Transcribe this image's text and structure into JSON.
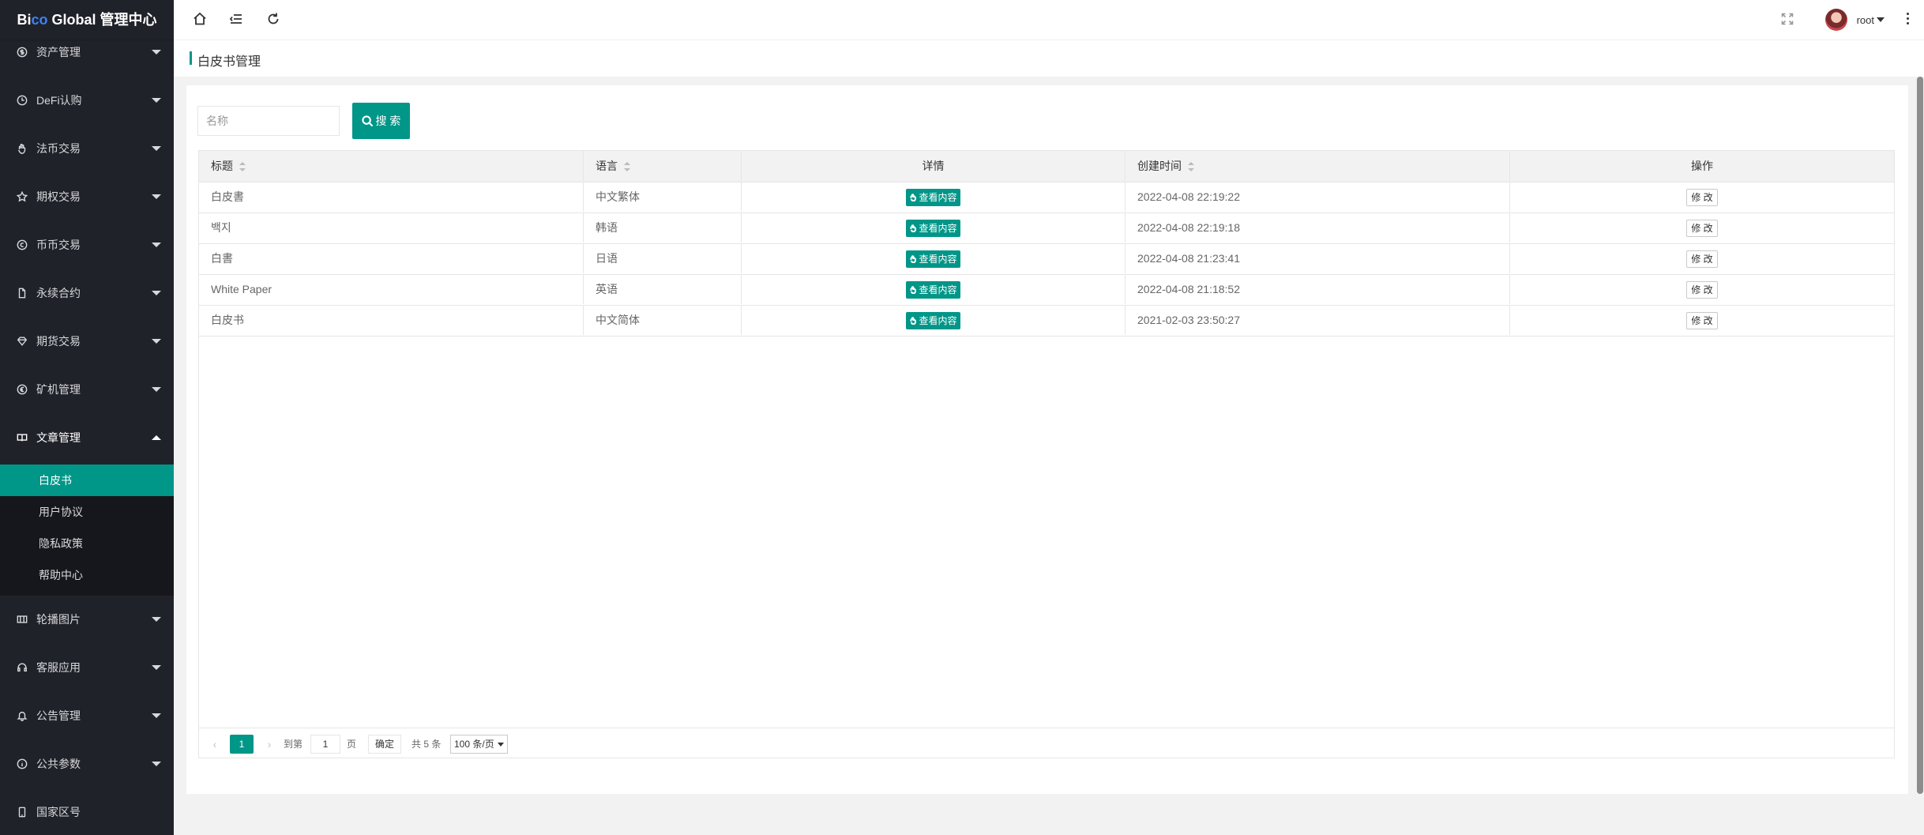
{
  "app": {
    "title_a": "Bi",
    "title_co": "co",
    "title_b": " Global 管理中心"
  },
  "sidebar": {
    "items": [
      {
        "label": "资产管理",
        "icon": "dollar-icon"
      },
      {
        "label": "DeFi认购",
        "icon": "clock-icon"
      },
      {
        "label": "法币交易",
        "icon": "hand-icon"
      },
      {
        "label": "期权交易",
        "icon": "star-icon"
      },
      {
        "label": "币币交易",
        "icon": "coin-icon"
      },
      {
        "label": "永续合约",
        "icon": "file-icon"
      },
      {
        "label": "期货交易",
        "icon": "diamond-icon"
      },
      {
        "label": "矿机管理",
        "icon": "euro-icon"
      },
      {
        "label": "文章管理",
        "icon": "book-icon"
      },
      {
        "label": "轮播图片",
        "icon": "image-icon"
      },
      {
        "label": "客服应用",
        "icon": "headset-icon"
      },
      {
        "label": "公告管理",
        "icon": "bell-icon"
      },
      {
        "label": "公共参数",
        "icon": "info-icon"
      },
      {
        "label": "国家区号",
        "icon": "phone-icon"
      }
    ],
    "submenu": [
      "白皮书",
      "用户协议",
      "隐私政策",
      "帮助中心"
    ]
  },
  "header": {
    "username": "root"
  },
  "page": {
    "title": "白皮书管理"
  },
  "search": {
    "placeholder": "名称",
    "button": "搜 索"
  },
  "table": {
    "columns": [
      "标题",
      "语言",
      "详情",
      "创建时间",
      "操作"
    ],
    "view_label": "查看内容",
    "edit_label": "修 改",
    "rows": [
      {
        "title": "白皮書",
        "lang": "中文繁体",
        "created": "2022-04-08 22:19:22"
      },
      {
        "title": "백지",
        "lang": "韩语",
        "created": "2022-04-08 22:19:18"
      },
      {
        "title": "白書",
        "lang": "日语",
        "created": "2022-04-08 21:23:41"
      },
      {
        "title": "White Paper",
        "lang": "英语",
        "created": "2022-04-08 21:18:52"
      },
      {
        "title": "白皮书",
        "lang": "中文简体",
        "created": "2021-02-03 23:50:27"
      }
    ]
  },
  "pager": {
    "current": "1",
    "goto_label": "到第",
    "page_value": "1",
    "page_unit": "页",
    "ok": "确定",
    "total": "共 5 条",
    "per_page": "100 条/页"
  },
  "colors": {
    "accent": "#009688",
    "sidebar_bg": "#20222a",
    "submenu_bg": "#16171c"
  }
}
